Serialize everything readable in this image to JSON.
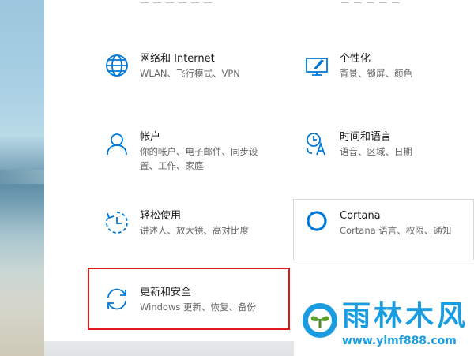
{
  "tiles": [
    {
      "name": "network",
      "title": "网络和 Internet",
      "desc": "WLAN、飞行模式、VPN",
      "icon": "globe-icon"
    },
    {
      "name": "personalization",
      "title": "个性化",
      "desc": "背景、锁屏、颜色",
      "icon": "personalize-icon"
    },
    {
      "name": "accounts",
      "title": "帐户",
      "desc_lines": [
        "你的帐户、电子邮件、同步设",
        "置、工作、家庭"
      ],
      "icon": "person-icon"
    },
    {
      "name": "time-language",
      "title": "时间和语言",
      "desc": "语音、区域、日期",
      "icon": "time-language-icon"
    },
    {
      "name": "ease-of-access",
      "title": "轻松使用",
      "desc": "讲述人、放大镜、高对比度",
      "icon": "ease-of-access-icon"
    },
    {
      "name": "cortana",
      "title": "Cortana",
      "desc": "Cortana 语言、权限、通知",
      "icon": "cortana-icon"
    },
    {
      "name": "update-security",
      "title": "更新和安全",
      "desc": "Windows 更新、恢复、备份",
      "icon": "sync-icon"
    }
  ],
  "watermark": {
    "title": "雨林木风",
    "url": "www.ylmf888.com"
  },
  "colors": {
    "accent": "#0078d7",
    "highlight": "#e0191d",
    "watermark": "#1a9de0"
  }
}
